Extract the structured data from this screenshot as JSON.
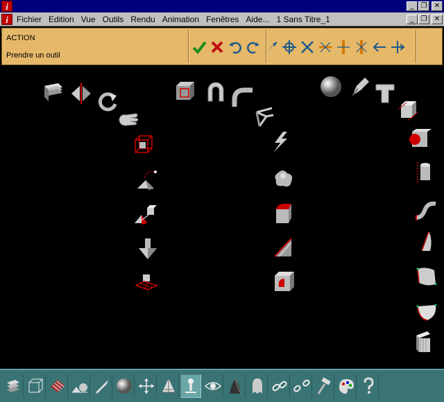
{
  "app": {
    "logo": "i",
    "minimize": "_",
    "restore": "❐",
    "close": "✕"
  },
  "menu": {
    "items": [
      "Fichier",
      "Edition",
      "Vue",
      "Outils",
      "Rendu",
      "Animation",
      "Fenêtres",
      "Aide...",
      "1 Sans Titre_1"
    ]
  },
  "action": {
    "title": "ACTION",
    "subtitle": "Prendre un outil"
  },
  "action_tools": [
    "check-icon",
    "cross-icon",
    "undo-icon",
    "redo-icon",
    "pick-arrow-icon",
    "target-icon",
    "x-axis-icon",
    "cross-orange-icon",
    "axis-orange-icon",
    "axis-orange-2-icon",
    "arrow-left-icon",
    "move-cross-icon"
  ],
  "bottom_tools": [
    "layers-icon",
    "cube-wire-icon",
    "brick-icon",
    "primitives-icon",
    "pen-icon",
    "sphere-icon",
    "move-arrows-icon",
    "grid-pyramid-icon",
    "figure-icon",
    "eye-icon",
    "cone-icon",
    "ghost-icon",
    "chain-icon",
    "chain-broken-icon",
    "hammer-icon",
    "palette-icon",
    "help-icon"
  ],
  "colors": {
    "titlebar": "#00007b",
    "actionbar": "#e6b86a",
    "bottombar": "#3a7373",
    "accent_red": "#c00000"
  }
}
